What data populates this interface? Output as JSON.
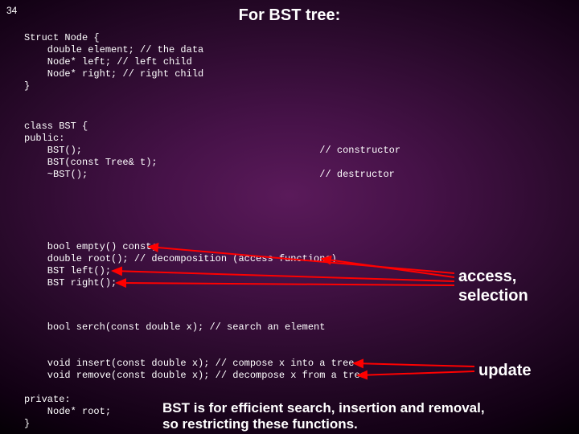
{
  "page_number": "34",
  "title": "For BST tree:",
  "struct_code": "Struct Node {\n    double element; // the data\n    Node* left; // left child\n    Node* right; // right child\n}",
  "class_head": "class BST {\npublic:\n    BST();                                         // constructor\n    BST(const Tree& t);\n    ~BST();                                        // destructor",
  "access_block": "    bool empty() const;\n    double root(); // decomposition (access functions)\n    BST left();\n    BST right();",
  "search_line": "    bool serch(const double x); // search an element",
  "update_block": "    void insert(const double x); // compose x into a tree\n    void remove(const double x); // decompose x from a tree",
  "private_block": "private:\n    Node* root;\n}",
  "annot_access": "access,\nselection",
  "annot_update": "update",
  "summary": "BST is for efficient search, insertion and removal,\nso restricting these functions.",
  "arrow_color": "#ff0000"
}
